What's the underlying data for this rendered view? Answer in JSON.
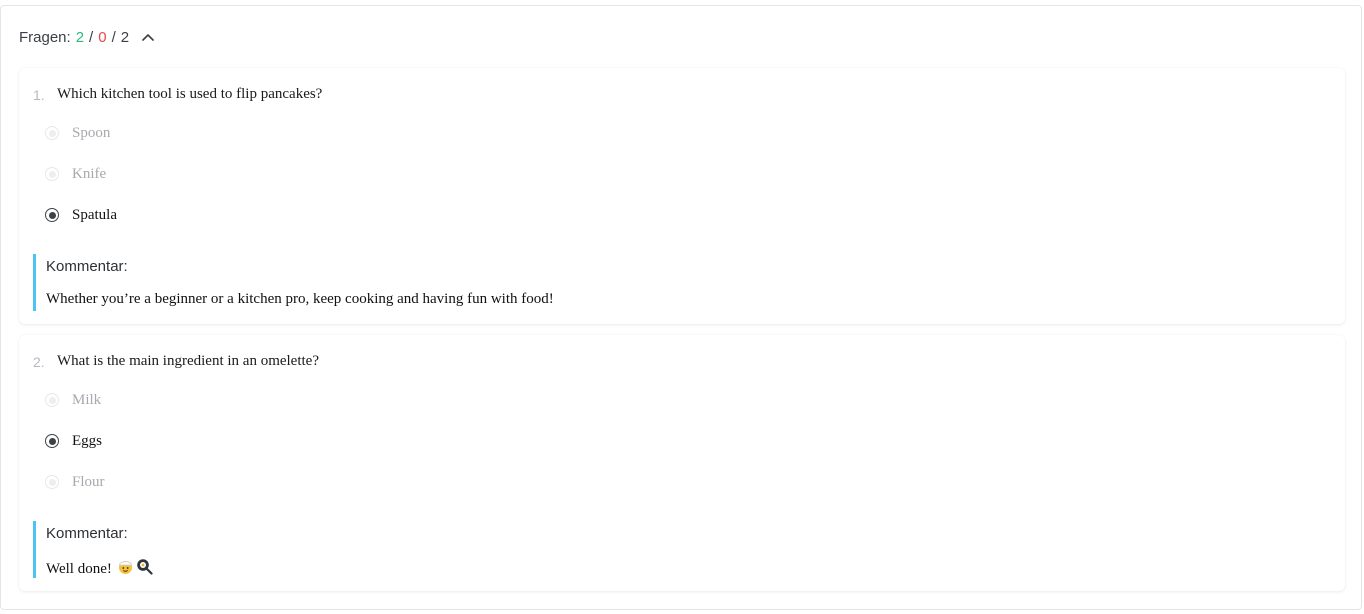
{
  "summary": {
    "label": "Fragen:",
    "correct": "2",
    "wrong": "0",
    "total": "2",
    "separator": "/",
    "toggle_icon": "chevron-up-icon",
    "colors": {
      "correct": "#2fb87d",
      "wrong": "#e5484d"
    }
  },
  "questions": [
    {
      "number": "1.",
      "text": "Which kitchen tool is used to flip pancakes?",
      "options": [
        {
          "label": "Spoon",
          "selected": false
        },
        {
          "label": "Knife",
          "selected": false
        },
        {
          "label": "Spatula",
          "selected": true
        }
      ],
      "comment_title": "Kommentar:",
      "comment_body": "Whether you’re a beginner or a kitchen pro, keep cooking and having fun with food!"
    },
    {
      "number": "2.",
      "text": "What is the main ingredient in an omelette?",
      "options": [
        {
          "label": "Milk",
          "selected": false
        },
        {
          "label": "Eggs",
          "selected": true
        },
        {
          "label": "Flour",
          "selected": false
        }
      ],
      "comment_title": "Kommentar:",
      "comment_body": "Well done!",
      "comment_emojis": [
        "cook-emoji-icon",
        "frying-pan-emoji-icon"
      ]
    }
  ],
  "accent_color": "#4cc3f0"
}
